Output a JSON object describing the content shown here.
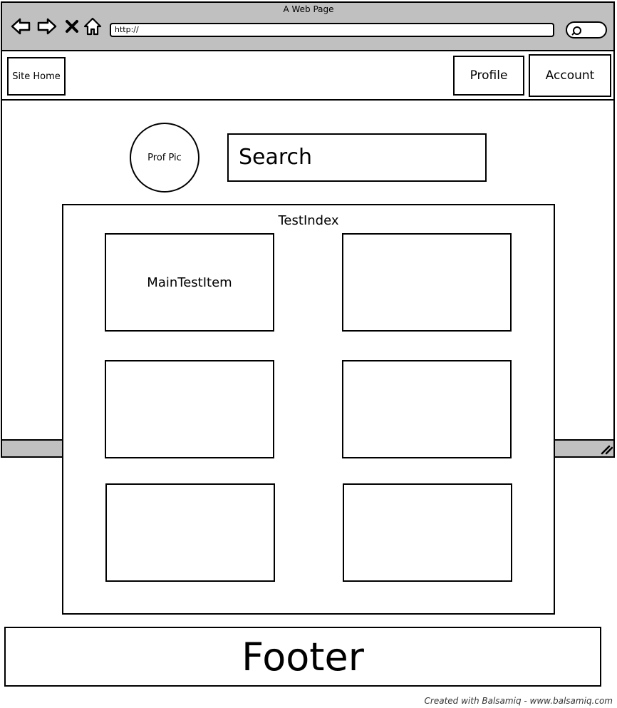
{
  "window": {
    "title": "A Web Page",
    "url": "http://"
  },
  "icons": {
    "back": "back-arrow-icon",
    "forward": "forward-arrow-icon",
    "stop": "close-icon",
    "home": "home-icon",
    "search": "search-icon",
    "resize": "resize-grip-icon"
  },
  "nav": {
    "site_home": "Site Home",
    "profile": "Profile",
    "account": "Account"
  },
  "profile_pic": {
    "label": "Prof Pic"
  },
  "search": {
    "placeholder": "Search"
  },
  "test_index": {
    "title": "TestIndex",
    "items": [
      {
        "label": "MainTestItem"
      },
      {
        "label": ""
      },
      {
        "label": ""
      },
      {
        "label": ""
      },
      {
        "label": ""
      },
      {
        "label": ""
      }
    ]
  },
  "footer": {
    "label": "Footer"
  },
  "credit": "Created with Balsamiq - www.balsamiq.com"
}
